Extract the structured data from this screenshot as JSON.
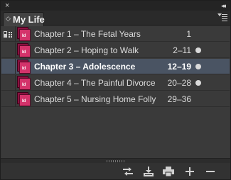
{
  "panel": {
    "tab_title": "My Life",
    "close_glyph": "×",
    "collapse_glyph": "◂◂",
    "chevron_glyph": "◇"
  },
  "documents": [
    {
      "name": "Chapter 1 – The Fetal Years",
      "pages": "1",
      "selected": false,
      "status_dot": false,
      "sync_icon": true
    },
    {
      "name": "Chapter 2 – Hoping to Walk",
      "pages": "2–11",
      "selected": false,
      "status_dot": true,
      "sync_icon": false
    },
    {
      "name": "Chapter 3 – Adolescence",
      "pages": "12–19",
      "selected": true,
      "status_dot": true,
      "sync_icon": false
    },
    {
      "name": "Chapter 4 – The Painful Divorce",
      "pages": "20–28",
      "selected": false,
      "status_dot": true,
      "sync_icon": false
    },
    {
      "name": "Chapter 5 – Nursing Home Folly",
      "pages": "29–36",
      "selected": false,
      "status_dot": false,
      "sync_icon": false
    }
  ],
  "doc_icon_label": "Id",
  "toolbar": {
    "buttons": [
      "synchronize-icon",
      "save-book-icon",
      "print-icon",
      "add-document-icon",
      "remove-document-icon"
    ]
  },
  "colors": {
    "panel_bg": "#383838",
    "selected_row": "#4a5463",
    "indesign_pink": "#d4336b"
  }
}
